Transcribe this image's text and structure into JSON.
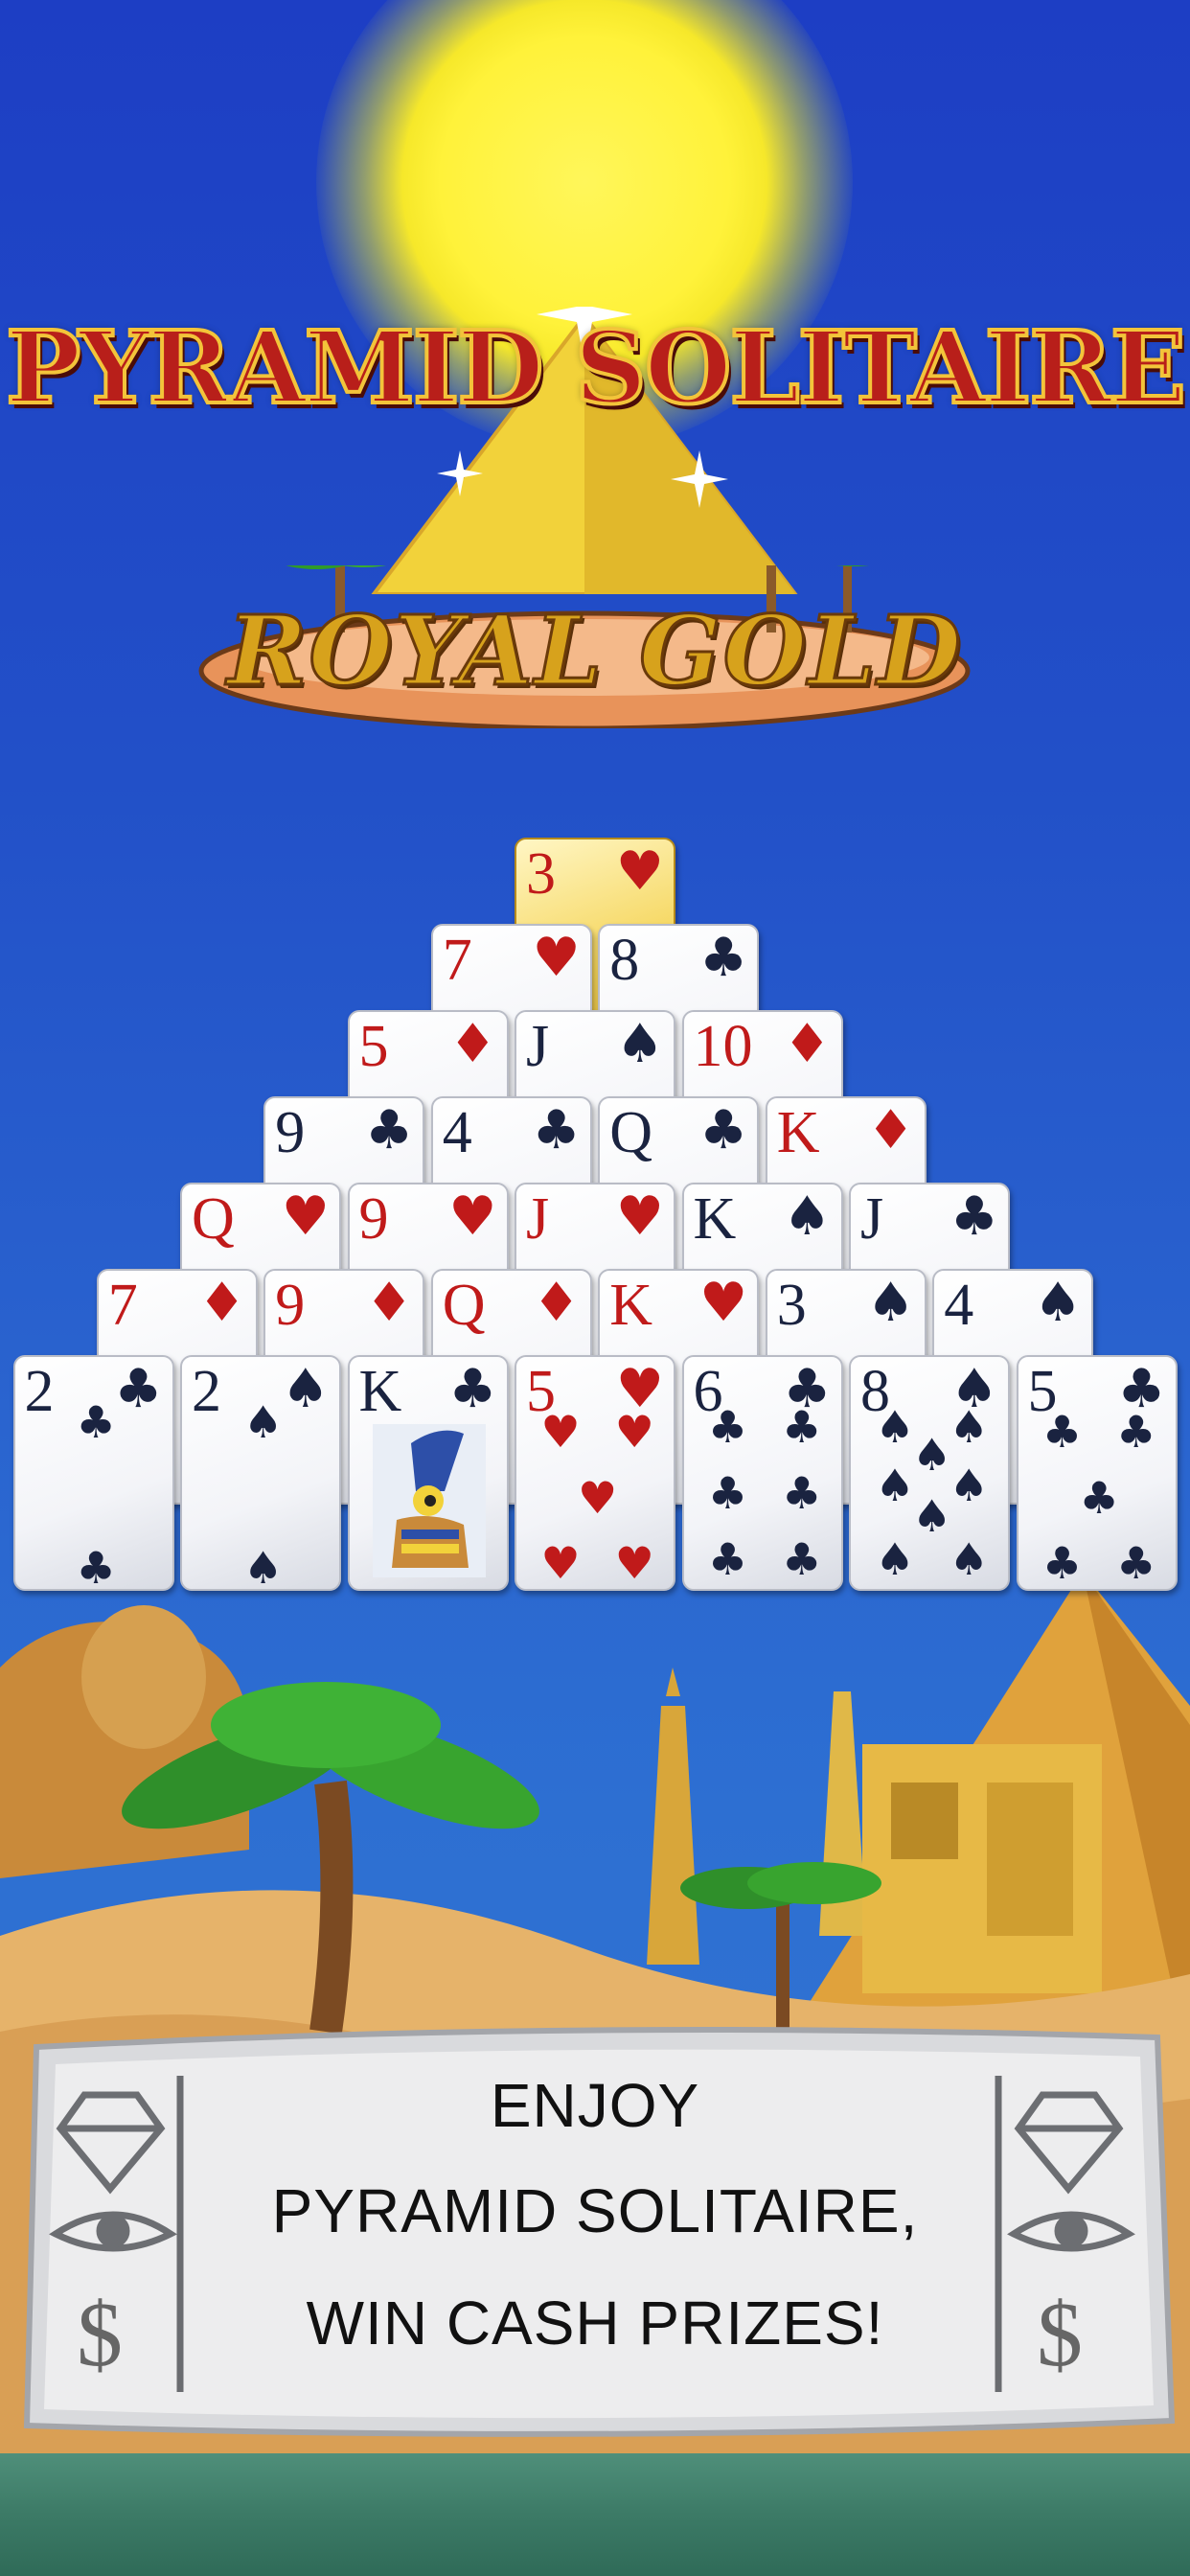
{
  "title": {
    "line1": "PYRAMID SOLITAIRE",
    "line2": "ROYAL GOLD"
  },
  "pyramid": {
    "rows": [
      [
        {
          "rank": "3",
          "suit": "♥",
          "color": "red",
          "gold": true
        }
      ],
      [
        {
          "rank": "7",
          "suit": "♥",
          "color": "red"
        },
        {
          "rank": "8",
          "suit": "♣",
          "color": "black"
        }
      ],
      [
        {
          "rank": "5",
          "suit": "♦",
          "color": "red"
        },
        {
          "rank": "J",
          "suit": "♠",
          "color": "black"
        },
        {
          "rank": "10",
          "suit": "♦",
          "color": "red"
        }
      ],
      [
        {
          "rank": "9",
          "suit": "♣",
          "color": "black"
        },
        {
          "rank": "4",
          "suit": "♣",
          "color": "black"
        },
        {
          "rank": "Q",
          "suit": "♣",
          "color": "black"
        },
        {
          "rank": "K",
          "suit": "♦",
          "color": "red"
        }
      ],
      [
        {
          "rank": "Q",
          "suit": "♥",
          "color": "red"
        },
        {
          "rank": "9",
          "suit": "♥",
          "color": "red"
        },
        {
          "rank": "J",
          "suit": "♥",
          "color": "red"
        },
        {
          "rank": "K",
          "suit": "♠",
          "color": "black"
        },
        {
          "rank": "J",
          "suit": "♣",
          "color": "black"
        }
      ],
      [
        {
          "rank": "7",
          "suit": "♦",
          "color": "red"
        },
        {
          "rank": "9",
          "suit": "♦",
          "color": "red"
        },
        {
          "rank": "Q",
          "suit": "♦",
          "color": "red"
        },
        {
          "rank": "K",
          "suit": "♥",
          "color": "red"
        },
        {
          "rank": "3",
          "suit": "♠",
          "color": "black"
        },
        {
          "rank": "4",
          "suit": "♠",
          "color": "black"
        }
      ],
      [
        {
          "rank": "2",
          "suit": "♣",
          "color": "black"
        },
        {
          "rank": "2",
          "suit": "♠",
          "color": "black"
        },
        {
          "rank": "K",
          "suit": "♣",
          "color": "black",
          "face": true
        },
        {
          "rank": "5",
          "suit": "♥",
          "color": "red"
        },
        {
          "rank": "6",
          "suit": "♣",
          "color": "black"
        },
        {
          "rank": "8",
          "suit": "♠",
          "color": "black"
        },
        {
          "rank": "5",
          "suit": "♣",
          "color": "black"
        }
      ]
    ]
  },
  "banner": {
    "line1": "ENJOY",
    "line2": "PYRAMID SOLITAIRE,",
    "line3": "WIN CASH PRIZES!",
    "left_icons": [
      "diamond-icon",
      "eye-icon",
      "dollar-icon"
    ],
    "right_icons": [
      "diamond-icon",
      "eye-icon",
      "dollar-icon"
    ],
    "dollar_symbol": "$"
  },
  "colors": {
    "sky": "#2250c8",
    "card_red": "#c01a1a",
    "card_black": "#1a2340",
    "gold_card": "#f5d55a",
    "title_red": "#b81f1a",
    "title_gold": "#d7a21c"
  }
}
